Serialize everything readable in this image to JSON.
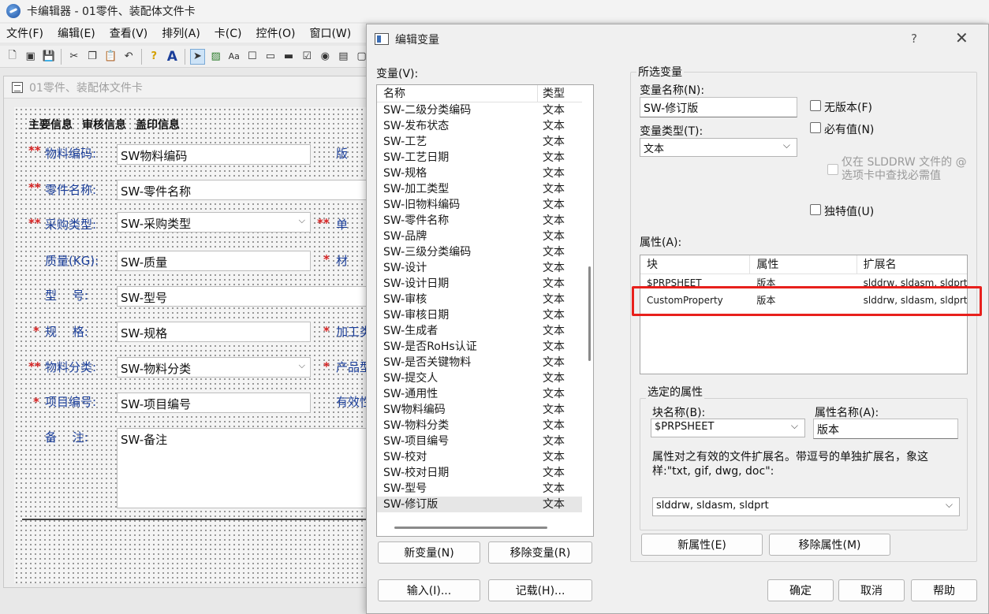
{
  "app": {
    "title": "卡编辑器 - 01零件、装配体文件卡",
    "menu": [
      "文件(F)",
      "编辑(E)",
      "查看(V)",
      "排列(A)",
      "卡(C)",
      "控件(O)",
      "窗口(W)"
    ],
    "inner_title": "01零件、装配体文件卡",
    "tabs": [
      "主要信息",
      "审核信息",
      "盖印信息"
    ],
    "form": {
      "material_code": {
        "label": "物料编码:",
        "value": "SW物料编码"
      },
      "part_name": {
        "label": "零件名称:",
        "value": "SW-零件名称"
      },
      "purchase_type": {
        "label": "采购类型:",
        "value": "SW-采购类型"
      },
      "weight": {
        "label": "质量(KG):",
        "value": "SW-质量"
      },
      "model": {
        "label": "型　 号:",
        "value": "SW-型号"
      },
      "spec": {
        "label": "规　 格:",
        "value": "SW-规格"
      },
      "category": {
        "label": "物料分类:",
        "value": "SW-物料分类"
      },
      "project_no": {
        "label": "项目编号:",
        "value": "SW-项目编号"
      },
      "remark": {
        "label": "备　 注:",
        "value": "SW-备注"
      },
      "right_col": [
        "版",
        "单",
        "材",
        "加工类",
        "产品型",
        "有效性"
      ]
    }
  },
  "dialog": {
    "title": "编辑变量",
    "help": "?",
    "variables_label": "变量(V):",
    "list_header": {
      "name": "名称",
      "type": "类型"
    },
    "variables": [
      {
        "name": "SW-二级分类编码",
        "type": "文本"
      },
      {
        "name": "SW-发布状态",
        "type": "文本"
      },
      {
        "name": "SW-工艺",
        "type": "文本"
      },
      {
        "name": "SW-工艺日期",
        "type": "文本"
      },
      {
        "name": "SW-规格",
        "type": "文本"
      },
      {
        "name": "SW-加工类型",
        "type": "文本"
      },
      {
        "name": "SW-旧物料编码",
        "type": "文本"
      },
      {
        "name": "SW-零件名称",
        "type": "文本"
      },
      {
        "name": "SW-品牌",
        "type": "文本"
      },
      {
        "name": "SW-三级分类编码",
        "type": "文本"
      },
      {
        "name": "SW-设计",
        "type": "文本"
      },
      {
        "name": "SW-设计日期",
        "type": "文本"
      },
      {
        "name": "SW-审核",
        "type": "文本"
      },
      {
        "name": "SW-审核日期",
        "type": "文本"
      },
      {
        "name": "SW-生成者",
        "type": "文本"
      },
      {
        "name": "SW-是否RoHs认证",
        "type": "文本"
      },
      {
        "name": "SW-是否关键物料",
        "type": "文本"
      },
      {
        "name": "SW-提交人",
        "type": "文本"
      },
      {
        "name": "SW-通用性",
        "type": "文本"
      },
      {
        "name": "SW物料编码",
        "type": "文本"
      },
      {
        "name": "SW-物料分类",
        "type": "文本"
      },
      {
        "name": "SW-项目编号",
        "type": "文本"
      },
      {
        "name": "SW-校对",
        "type": "文本"
      },
      {
        "name": "SW-校对日期",
        "type": "文本"
      },
      {
        "name": "SW-型号",
        "type": "文本"
      },
      {
        "name": "SW-修订版",
        "type": "文本",
        "selected": true
      }
    ],
    "new_var": "新变量(N)",
    "remove_var": "移除变量(R)",
    "import": "输入(I)...",
    "record": "记载(H)...",
    "selected_var_group": "所选变量",
    "var_name_label": "变量名称(N):",
    "var_name_value": "SW-修订版",
    "var_type_label": "变量类型(T):",
    "var_type_value": "文本",
    "cb_no_version": "无版本(F)",
    "cb_required": "必有值(N)",
    "cb_slddrw_line1": "仅在 SLDDRW 文件的 @",
    "cb_slddrw_line2": "选项卡中查找必需值",
    "cb_unique": "独特值(U)",
    "attrs_label": "属性(A):",
    "attr_header": {
      "block": "块",
      "attr": "属性",
      "ext": "扩展名"
    },
    "attrs": [
      {
        "block": "$PRPSHEET",
        "attr": "版本",
        "ext": "slddrw, sldasm, sldprt"
      },
      {
        "block": "CustomProperty",
        "attr": "版本",
        "ext": "slddrw, sldasm, sldprt"
      }
    ],
    "selected_attr_group": "选定的属性",
    "block_name_label": "块名称(B):",
    "block_name_value": "$PRPSHEET",
    "attr_name_label": "属性名称(A):",
    "attr_name_value": "版本",
    "ext_desc": "属性对之有效的文件扩展名。带逗号的单独扩展名，象这样:\"txt, gif, dwg, doc\":",
    "ext_value": "slddrw, sldasm, sldprt",
    "new_attr": "新属性(E)",
    "remove_attr": "移除属性(M)",
    "ok": "确定",
    "cancel": "取消",
    "help_btn": "帮助"
  },
  "colors": {
    "highlight": "#e8201c",
    "label_blue": "#1a3e9a",
    "required_star": "#d62020"
  }
}
